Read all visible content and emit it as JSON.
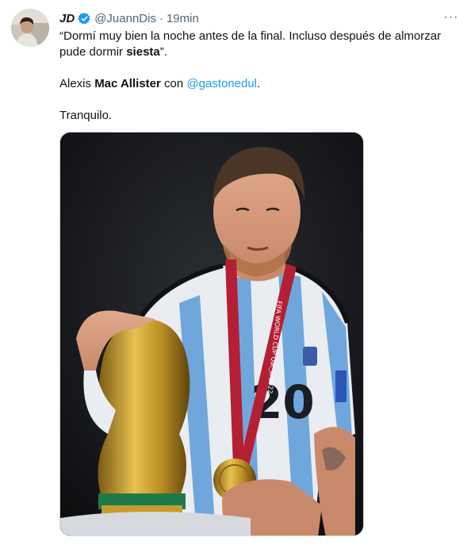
{
  "author": {
    "name": "JD",
    "handle": "@JuannDis",
    "separator": "·",
    "time": "19min"
  },
  "icons": {
    "verified": "verified-badge-icon",
    "more": "more-options-icon",
    "avatar": "avatar"
  },
  "tweet": {
    "line1_quote_open": "“Dormí muy bien la noche antes de la final. Incluso después de almorzar pude dormir ",
    "line1_bold": "siesta",
    "line1_quote_close": "”.",
    "p2_prefix": "Alexis ",
    "p2_bold": "Mac Allister",
    "p2_mid": " con ",
    "p2_mention": "@gastonedul",
    "p2_suffix": ".",
    "p3": "Tranquilo."
  },
  "image_text": {
    "jersey_number": "20",
    "medal_ribbon": "FIFA WORLD CUP Qat_ar2022"
  },
  "colors": {
    "link": "#1d9bf0",
    "verified": "#1d9bf0",
    "muted": "#536471"
  },
  "more_glyph": "···"
}
